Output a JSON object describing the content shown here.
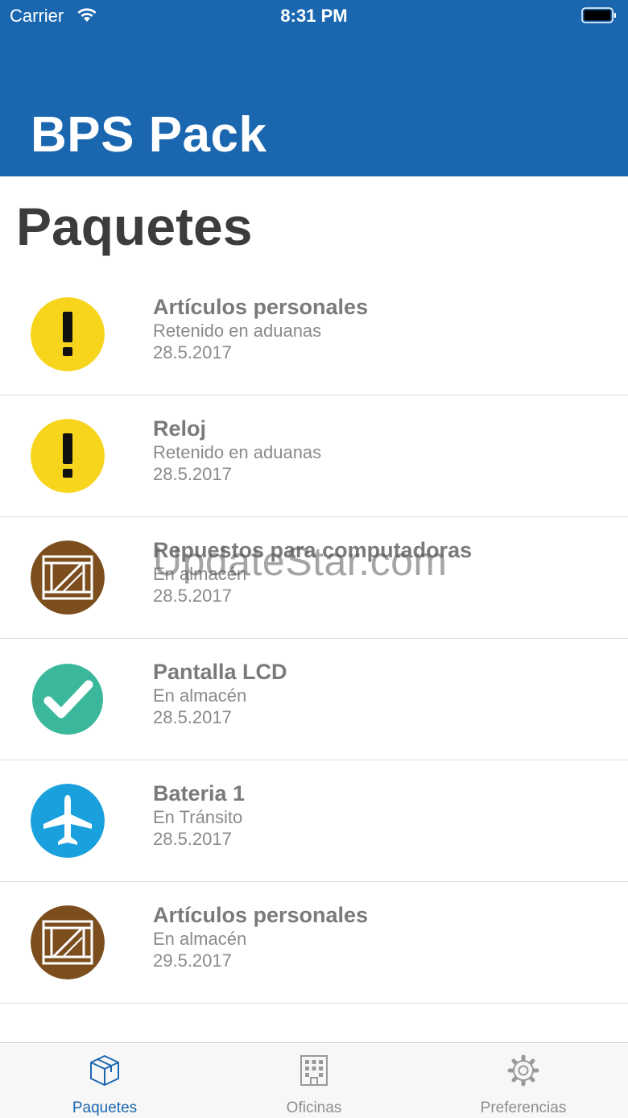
{
  "status_bar": {
    "carrier": "Carrier",
    "time": "8:31 PM"
  },
  "app": {
    "title": "BPS Pack"
  },
  "page": {
    "title": "Paquetes"
  },
  "packages": [
    {
      "title": "Artículos personales",
      "status": "Retenido en aduanas",
      "date": "28.5.2017",
      "icon": "warning-icon"
    },
    {
      "title": "Reloj",
      "status": "Retenido en aduanas",
      "date": "28.5.2017",
      "icon": "warning-icon"
    },
    {
      "title": "Repuestos para computadoras",
      "status": "En almacén",
      "date": "28.5.2017",
      "icon": "crate-icon"
    },
    {
      "title": "Pantalla LCD",
      "status": "En almacén",
      "date": "28.5.2017",
      "icon": "checkmark-icon"
    },
    {
      "title": "Bateria 1",
      "status": "En Tránsito",
      "date": "28.5.2017",
      "icon": "airplane-icon"
    },
    {
      "title": "Artículos personales",
      "status": "En almacén",
      "date": "29.5.2017",
      "icon": "crate-icon"
    }
  ],
  "watermark": "UpdateStar.com",
  "tabs": [
    {
      "label": "Paquetes",
      "icon": "package-icon",
      "active": true
    },
    {
      "label": "Oficinas",
      "icon": "building-icon",
      "active": false
    },
    {
      "label": "Preferencias",
      "icon": "gear-icon",
      "active": false
    }
  ],
  "colors": {
    "header": "#1a67b0",
    "warning": "#f7d51d",
    "crate": "#7c4e1e",
    "check": "#3bb89c",
    "transit": "#1aa0dd"
  }
}
